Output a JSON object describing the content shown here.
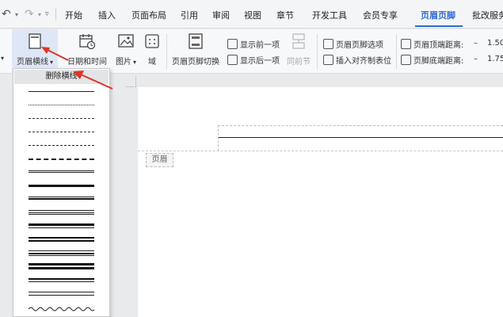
{
  "quick_access": {
    "undo": "↶",
    "redo": "↷",
    "dropdown": "▾",
    "more": "▿"
  },
  "tabs": [
    {
      "label": "开始"
    },
    {
      "label": "插入"
    },
    {
      "label": "页面布局"
    },
    {
      "label": "引用"
    },
    {
      "label": "审阅"
    },
    {
      "label": "视图"
    },
    {
      "label": "章节"
    },
    {
      "label": "开发工具"
    },
    {
      "label": "会员专享"
    },
    {
      "label": "页眉页脚"
    },
    {
      "label": "批改服务"
    }
  ],
  "ribbon": {
    "header_line": "页眉横线",
    "header_line_dd": "▾",
    "datetime": "日期和时间",
    "picture": "图片",
    "picture_dd": "▾",
    "field": "域",
    "switch": "页眉页脚切换",
    "show_prev": "显示前一项",
    "show_next": "显示后一项",
    "same_as_prev": "同前节",
    "hf_options": "页眉页脚选项",
    "insert_align_tab": "插入对齐制表位",
    "header_top_distance_label": "页眉顶端距离:",
    "header_top_distance_value": "1.50",
    "footer_bottom_distance_label": "页脚底端距离:",
    "footer_bottom_distance_value": "1.75",
    "minus": "–"
  },
  "dropdown": {
    "remove_label": "删除横线",
    "line_styles": [
      "single-thin",
      "dotted",
      "dashed",
      "dash-dot",
      "long-dash",
      "double-dash",
      "double",
      "thick",
      "thin-thick",
      "triple",
      "thick-thin",
      "thick-double",
      "thin-thick-thin",
      "thick-thick",
      "double-thin",
      "wavy"
    ]
  },
  "document": {
    "header_tag": "页眉"
  },
  "colors": {
    "accent": "#2f6bd6",
    "arrow": "#e0342a"
  }
}
